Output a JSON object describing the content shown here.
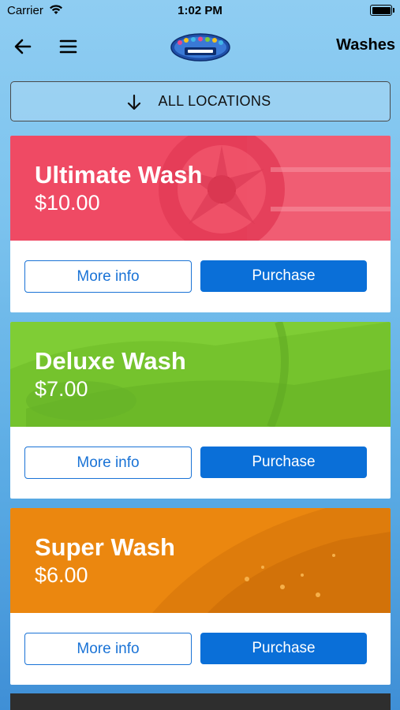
{
  "status_bar": {
    "carrier": "Carrier",
    "time": "1:02 PM"
  },
  "nav": {
    "title": "Washes",
    "logo_alt": "Bubbles Car Wash"
  },
  "location_filter": {
    "label": "ALL LOCATIONS"
  },
  "washes": [
    {
      "name": "Ultimate Wash",
      "price": "$10.00",
      "color": "#ef4a64",
      "more_info": "More info",
      "purchase": "Purchase"
    },
    {
      "name": "Deluxe Wash",
      "price": "$7.00",
      "color": "#7fcd35",
      "more_info": "More info",
      "purchase": "Purchase"
    },
    {
      "name": "Super Wash",
      "price": "$6.00",
      "color": "#eb870f",
      "more_info": "More info",
      "purchase": "Purchase"
    }
  ]
}
